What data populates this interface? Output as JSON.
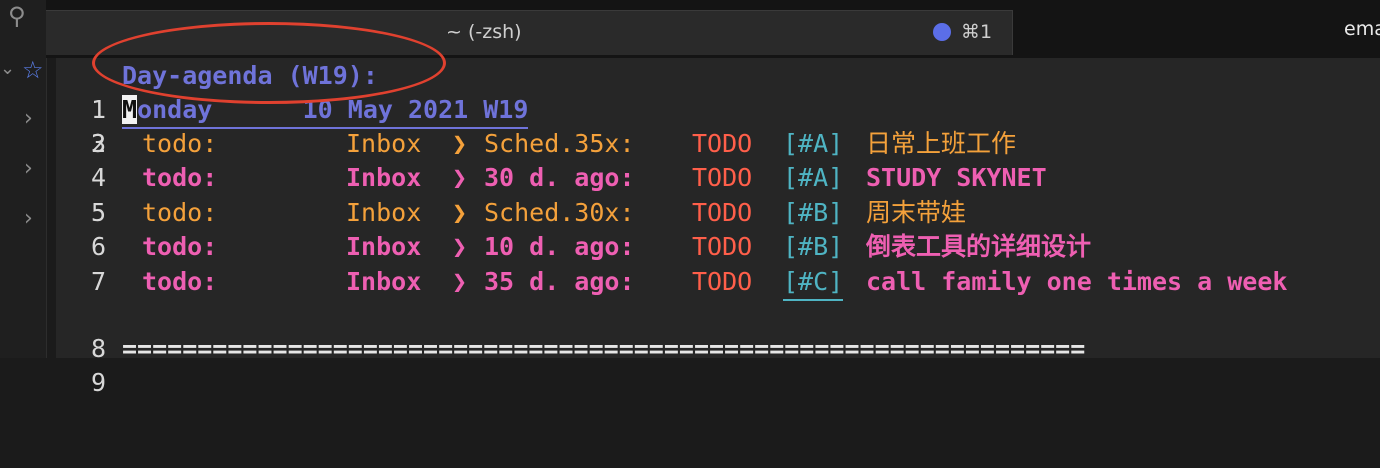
{
  "tab": {
    "title": "~ (-zsh)",
    "shortcut": "⌘1",
    "second_tab": "ema",
    "dot_color": "#5b6ee8"
  },
  "sidebar": {
    "icons": [
      "search-icon",
      "chevron-down-icon",
      "star-icon",
      "chevron-right-icon",
      "chevron-right-icon",
      "chevron-right-icon"
    ]
  },
  "agenda": {
    "header": "Day-agenda (W19):",
    "date": {
      "cursor_char": "M",
      "rest": "onday      10 May 2021 W19"
    },
    "items": [
      {
        "ln": "3",
        "kw": "todo:",
        "cat": "Inbox",
        "arrow": "❯",
        "sched": "Sched.35x:",
        "todo": "TODO",
        "prio": "[#A]",
        "title": "日常上班工作",
        "style": "orange"
      },
      {
        "ln": "4",
        "kw": "todo:",
        "cat": "Inbox",
        "arrow": "❯",
        "sched": "30 d. ago:",
        "todo": "TODO",
        "prio": "[#A]",
        "title": "STUDY SKYNET",
        "style": "pink"
      },
      {
        "ln": "5",
        "kw": "todo:",
        "cat": "Inbox",
        "arrow": "❯",
        "sched": "Sched.30x:",
        "todo": "TODO",
        "prio": "[#B]",
        "title": "周末带娃",
        "style": "orange"
      },
      {
        "ln": "6",
        "kw": "todo:",
        "cat": "Inbox",
        "arrow": "❯",
        "sched": "10 d. ago:",
        "todo": "TODO",
        "prio": "[#B]",
        "title": "倒表工具的详细设计",
        "style": "pink"
      },
      {
        "ln": "7",
        "kw": "todo:",
        "cat": "Inbox",
        "arrow": "❯",
        "sched": "35 d. ago:",
        "todo": "TODO",
        "prio": "[#C]",
        "title": "call family one times a week",
        "style": "pink"
      }
    ],
    "line_numbers": {
      "header": "1",
      "date": "2",
      "blank": "8",
      "sep": "9"
    },
    "separator": "================================================================"
  }
}
